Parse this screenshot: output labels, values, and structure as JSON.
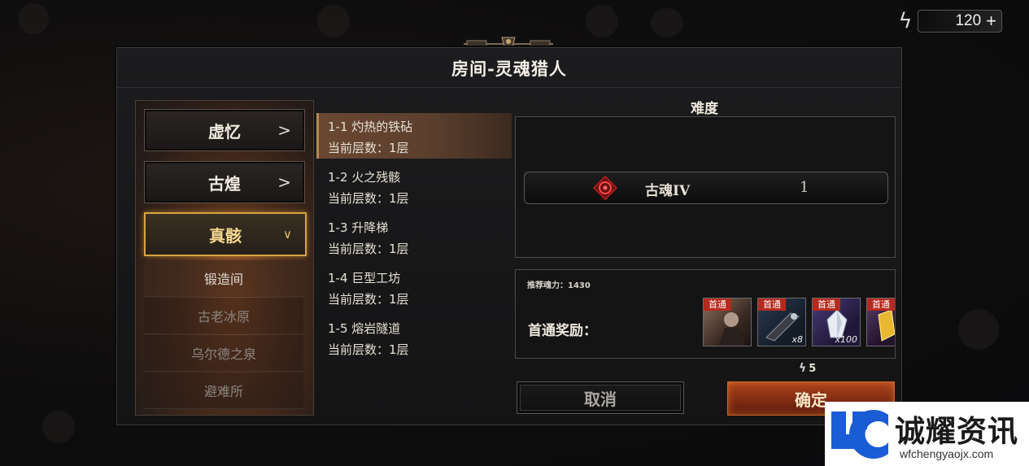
{
  "currency": {
    "icon": "lightning-icon",
    "value": "120",
    "add_label": "+"
  },
  "dialog": {
    "title": "房间-灵魂猎人",
    "categories": [
      {
        "label": "虚忆",
        "state": "collapsed"
      },
      {
        "label": "古煌",
        "state": "collapsed"
      },
      {
        "label": "真骸",
        "state": "expanded"
      }
    ],
    "sub_areas": [
      "锻造间",
      "古老冰原",
      "乌尔德之泉",
      "避难所"
    ],
    "stages": [
      {
        "name": "1-1 灼热的铁砧",
        "floor": "当前层数：1层"
      },
      {
        "name": "1-2 火之残骸",
        "floor": "当前层数：1层"
      },
      {
        "name": "1-3 升降梯",
        "floor": "当前层数：1层"
      },
      {
        "name": "1-4 巨型工坊",
        "floor": "当前层数：1层"
      },
      {
        "name": "1-5 熔岩隧道",
        "floor": "当前层数：1层"
      }
    ],
    "difficulty": {
      "label": "难度",
      "name": "古魂IV",
      "level": "1"
    },
    "rewards": {
      "recommended_power": "推荐魂力：1430",
      "label": "首通奖励：",
      "items": [
        {
          "tag": "首通",
          "qty": ""
        },
        {
          "tag": "首通",
          "qty": "x8"
        },
        {
          "tag": "首通",
          "qty": "x100"
        },
        {
          "tag": "首通",
          "qty": ""
        }
      ]
    },
    "cost": "5",
    "cancel_label": "取消",
    "confirm_label": "确定"
  },
  "watermark": {
    "name": "诚耀资讯",
    "url": "wfchengyaojx.com"
  },
  "colors": {
    "accent_gold": "#d7a440",
    "confirm_red": "#8a2e14",
    "reward_tag": "#b52a1e"
  }
}
